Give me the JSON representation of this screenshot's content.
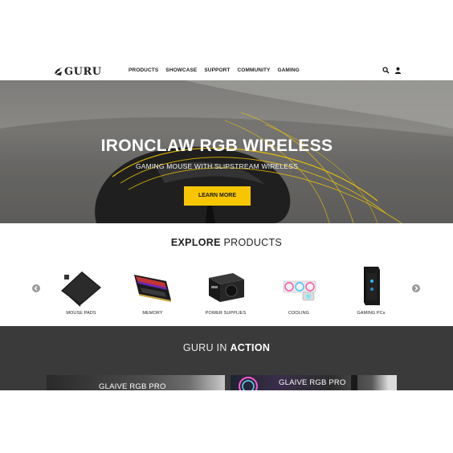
{
  "nav": {
    "logo_text": "GURU",
    "items": [
      {
        "label": "PRODUCTS"
      },
      {
        "label": "SHOWCASE"
      },
      {
        "label": "SUPPORT"
      },
      {
        "label": "COMMUNITY"
      },
      {
        "label": "GAMING"
      }
    ],
    "icons": [
      "search-icon",
      "user-icon"
    ]
  },
  "hero": {
    "title": "IRONCLAW RGB WIRELESS",
    "subtitle": "GAMING MOUSE WITH SLIPSTREAM WIRELESS",
    "cta_label": "LEARN MORE",
    "accent_color": "#f7c600"
  },
  "explore": {
    "title_bold": "EXPLORE",
    "title_rest": " PRODUCTS",
    "products": [
      {
        "label": "MOUSE PADS",
        "icon": "mousepad-icon"
      },
      {
        "label": "MEMORY",
        "icon": "memory-icon"
      },
      {
        "label": "POWER SUPPLIES",
        "icon": "power-supply-icon"
      },
      {
        "label": "COOLING",
        "icon": "cooling-icon"
      },
      {
        "label": "GAMING PCs",
        "icon": "gaming-pc-icon"
      }
    ]
  },
  "action": {
    "title_plain": "GURU IN ",
    "title_bold": "ACTION",
    "cards": [
      {
        "label": "GLAIVE RGB PRO"
      },
      {
        "label": "GLAIVE RGB PRO"
      }
    ]
  }
}
